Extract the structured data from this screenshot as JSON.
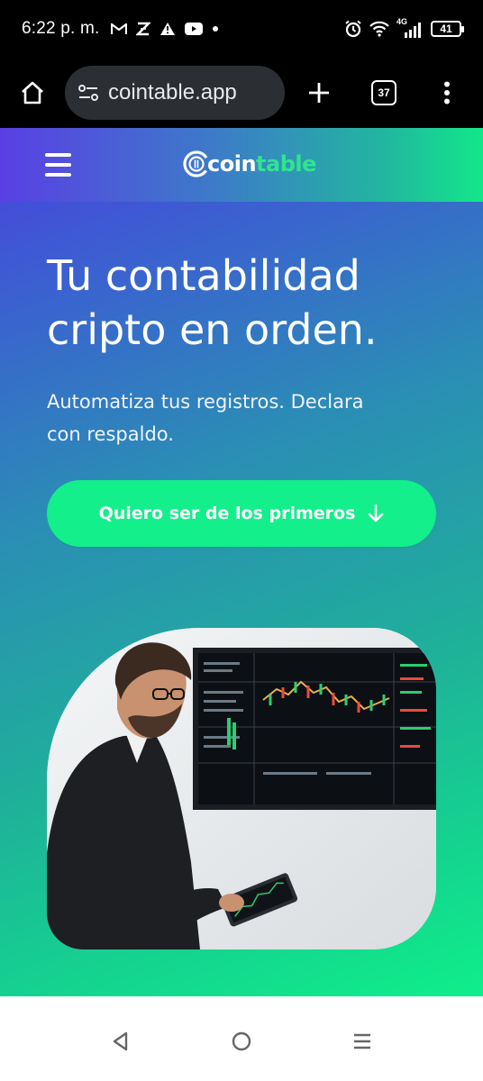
{
  "status_bar": {
    "time": "6:22 p. m.",
    "network": "4G",
    "battery": "41",
    "icons": [
      "gmail-icon",
      "z-app-icon",
      "warning-icon",
      "youtube-icon",
      "dot-icon",
      "alarm-icon",
      "wifi-icon",
      "signal-icon",
      "battery-icon"
    ]
  },
  "browser": {
    "url": "cointable.app",
    "tab_count": "37",
    "icons": [
      "home-icon",
      "site-settings-icon",
      "new-tab-icon",
      "tabs-icon",
      "menu-icon"
    ]
  },
  "site": {
    "logo_main": "coin",
    "logo_accent": "table",
    "hero_title_line1": "Tu contabilidad",
    "hero_title_line2": "cripto en orden.",
    "hero_sub_line1": "Automatiza tus registros. Declara",
    "hero_sub_line2": "con respaldo.",
    "cta_label": "Quiero ser de los primeros",
    "colors": {
      "accent_green": "#13ef8b",
      "gradient_start": "#4b3fe0",
      "gradient_end": "#0fee8a"
    }
  },
  "nav": {
    "icons": [
      "back-icon",
      "home-circle-icon",
      "recents-icon"
    ]
  }
}
